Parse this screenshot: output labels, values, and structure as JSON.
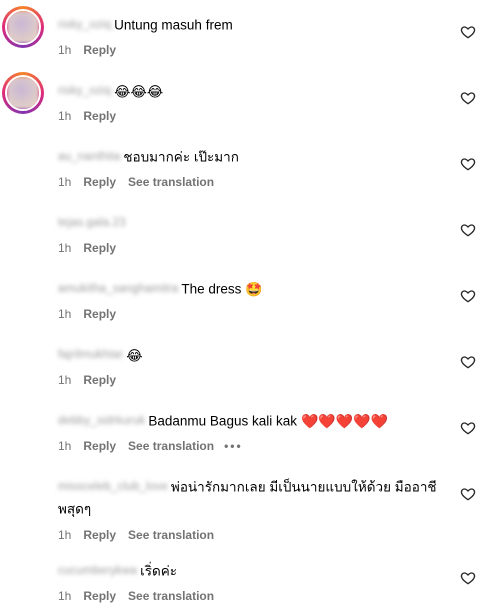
{
  "comments": [
    {
      "username": "risky_oziq",
      "text": "Untung masuh frem",
      "emoji": "",
      "time": "1h",
      "reply_label": "Reply",
      "see_translation": "",
      "more": "",
      "avatar_colors": [
        "#c9b7d6",
        "#e7d5c2"
      ],
      "has_story_ring": true
    },
    {
      "username": "risky_oziq",
      "text": "",
      "emoji": "😂😂😂",
      "time": "1h",
      "reply_label": "Reply",
      "see_translation": "",
      "more": "",
      "avatar_colors": [
        "#c9b7d6",
        "#e7d5c2"
      ],
      "has_story_ring": true
    },
    {
      "username": "au_nanthita",
      "text": "ชอบมากค่ะ เป๊ะมาก",
      "emoji": "",
      "time": "1h",
      "reply_label": "Reply",
      "see_translation": "See translation",
      "more": "",
      "avatar_colors": [
        "#d9d9d9",
        "#6f6f6f"
      ],
      "has_story_ring": false
    },
    {
      "username": "tejas.gala.23",
      "text": "",
      "emoji": "",
      "time": "1h",
      "reply_label": "Reply",
      "see_translation": "",
      "more": "",
      "avatar_colors": [
        "#b07a2a",
        "#3a2a1a"
      ],
      "has_story_ring": false
    },
    {
      "username": "amukitha_sanghamitra",
      "text": "The dress",
      "emoji": "🤩",
      "time": "1h",
      "reply_label": "Reply",
      "see_translation": "",
      "more": "",
      "avatar_colors": [
        "#3a2a28",
        "#b05040"
      ],
      "has_story_ring": false
    },
    {
      "username": "fajrilmukhtar",
      "text": "",
      "emoji": "😂",
      "time": "1h",
      "reply_label": "Reply",
      "see_translation": "",
      "more": "",
      "avatar_colors": [
        "#e8d800",
        "#4a3a2a"
      ],
      "has_story_ring": false
    },
    {
      "username": "debby_sidrkuruk",
      "text": "Badanmu Bagus kali kak",
      "emoji": "❤️❤️❤️❤️❤️",
      "time": "1h",
      "reply_label": "Reply",
      "see_translation": "See translation",
      "more": "•••",
      "avatar_colors": [
        "#c7a07a",
        "#8a5a3a"
      ],
      "has_story_ring": false
    },
    {
      "username": "missceleb_club_love",
      "text": "พ่อน่ารักมากเลย มีเป็นนายแบบให้ด้วย มืออาชีพสุดๆ",
      "emoji": "",
      "time": "1h",
      "reply_label": "Reply",
      "see_translation": "See translation",
      "more": "",
      "avatar_colors": [
        "#6a8a5a",
        "#a7b7c7"
      ],
      "has_story_ring": false
    },
    {
      "username": "cucumberykwa",
      "text": "เริ่ดค่ะ",
      "emoji": "",
      "time": "1h",
      "reply_label": "Reply",
      "see_translation": "See translation",
      "more": "",
      "avatar_colors": [
        "#d5c7e0",
        "#8a7a9a"
      ],
      "has_story_ring": false
    }
  ],
  "icons": {
    "like": "heart-outline-icon"
  }
}
